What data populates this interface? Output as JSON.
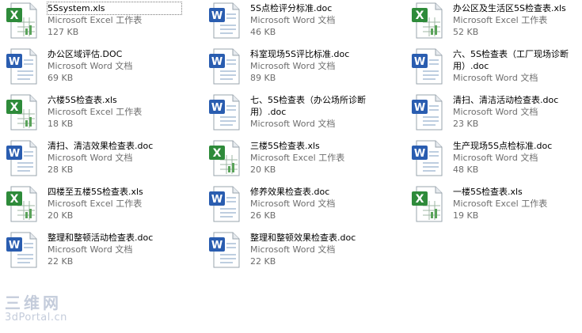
{
  "files": [
    {
      "name": "5Ssystem.xls",
      "type": "Microsoft Excel 工作表",
      "size": "127 KB",
      "icon": "excel-icon",
      "selected": true
    },
    {
      "name": "5S点检评分标准.doc",
      "type": "Microsoft Word 文档",
      "size": "46 KB",
      "icon": "word-icon"
    },
    {
      "name": "办公区及生活区5S检查表.xls",
      "type": "Microsoft Excel 工作表",
      "size": "52 KB",
      "icon": "excel-icon"
    },
    {
      "name": "办公区域评估.DOC",
      "type": "Microsoft Word 文档",
      "size": "69 KB",
      "icon": "word-icon"
    },
    {
      "name": "科室现场5S评比标准.doc",
      "type": "Microsoft Word 文档",
      "size": "89 KB",
      "icon": "word-icon"
    },
    {
      "name": "六、5S检查表（工厂现场诊断用）.doc",
      "type": "Microsoft Word 文档",
      "size": "",
      "icon": "word-icon"
    },
    {
      "name": "六楼5S检查表.xls",
      "type": "Microsoft Excel 工作表",
      "size": "18 KB",
      "icon": "excel-icon"
    },
    {
      "name": "七、5S检查表（办公场所诊断用）.doc",
      "type": "Microsoft Word 文档",
      "size": "",
      "icon": "word-icon"
    },
    {
      "name": "清扫、清洁活动检查表.doc",
      "type": "Microsoft Word 文档",
      "size": "23 KB",
      "icon": "word-icon"
    },
    {
      "name": "清扫、清洁效果检查表.doc",
      "type": "Microsoft Word 文档",
      "size": "28 KB",
      "icon": "word-icon"
    },
    {
      "name": "三楼5S检查表.xls",
      "type": "Microsoft Excel 工作表",
      "size": "20 KB",
      "icon": "excel-icon"
    },
    {
      "name": "生产现场5S点检标准.doc",
      "type": "Microsoft Word 文档",
      "size": "48 KB",
      "icon": "word-icon"
    },
    {
      "name": "四楼至五楼5S检查表.xls",
      "type": "Microsoft Excel 工作表",
      "size": "20 KB",
      "icon": "excel-icon"
    },
    {
      "name": "修养效果检查表.doc",
      "type": "Microsoft Word 文档",
      "size": "26 KB",
      "icon": "word-icon"
    },
    {
      "name": "一楼5S检查表.xls",
      "type": "Microsoft Excel 工作表",
      "size": "19 KB",
      "icon": "excel-icon"
    },
    {
      "name": "整理和整顿活动检查表.doc",
      "type": "Microsoft Word 文档",
      "size": "22 KB",
      "icon": "word-icon"
    },
    {
      "name": "整理和整顿效果检查表.doc",
      "type": "Microsoft Word 文档",
      "size": "22 KB",
      "icon": "word-icon"
    }
  ],
  "watermark": {
    "line1": "三维网",
    "line2": "3dPortal.cn"
  },
  "colors": {
    "excel": "#2e8b3a",
    "word": "#2a5db0",
    "meta_text": "#6d6d6d",
    "watermark": "#c4ccdb"
  }
}
